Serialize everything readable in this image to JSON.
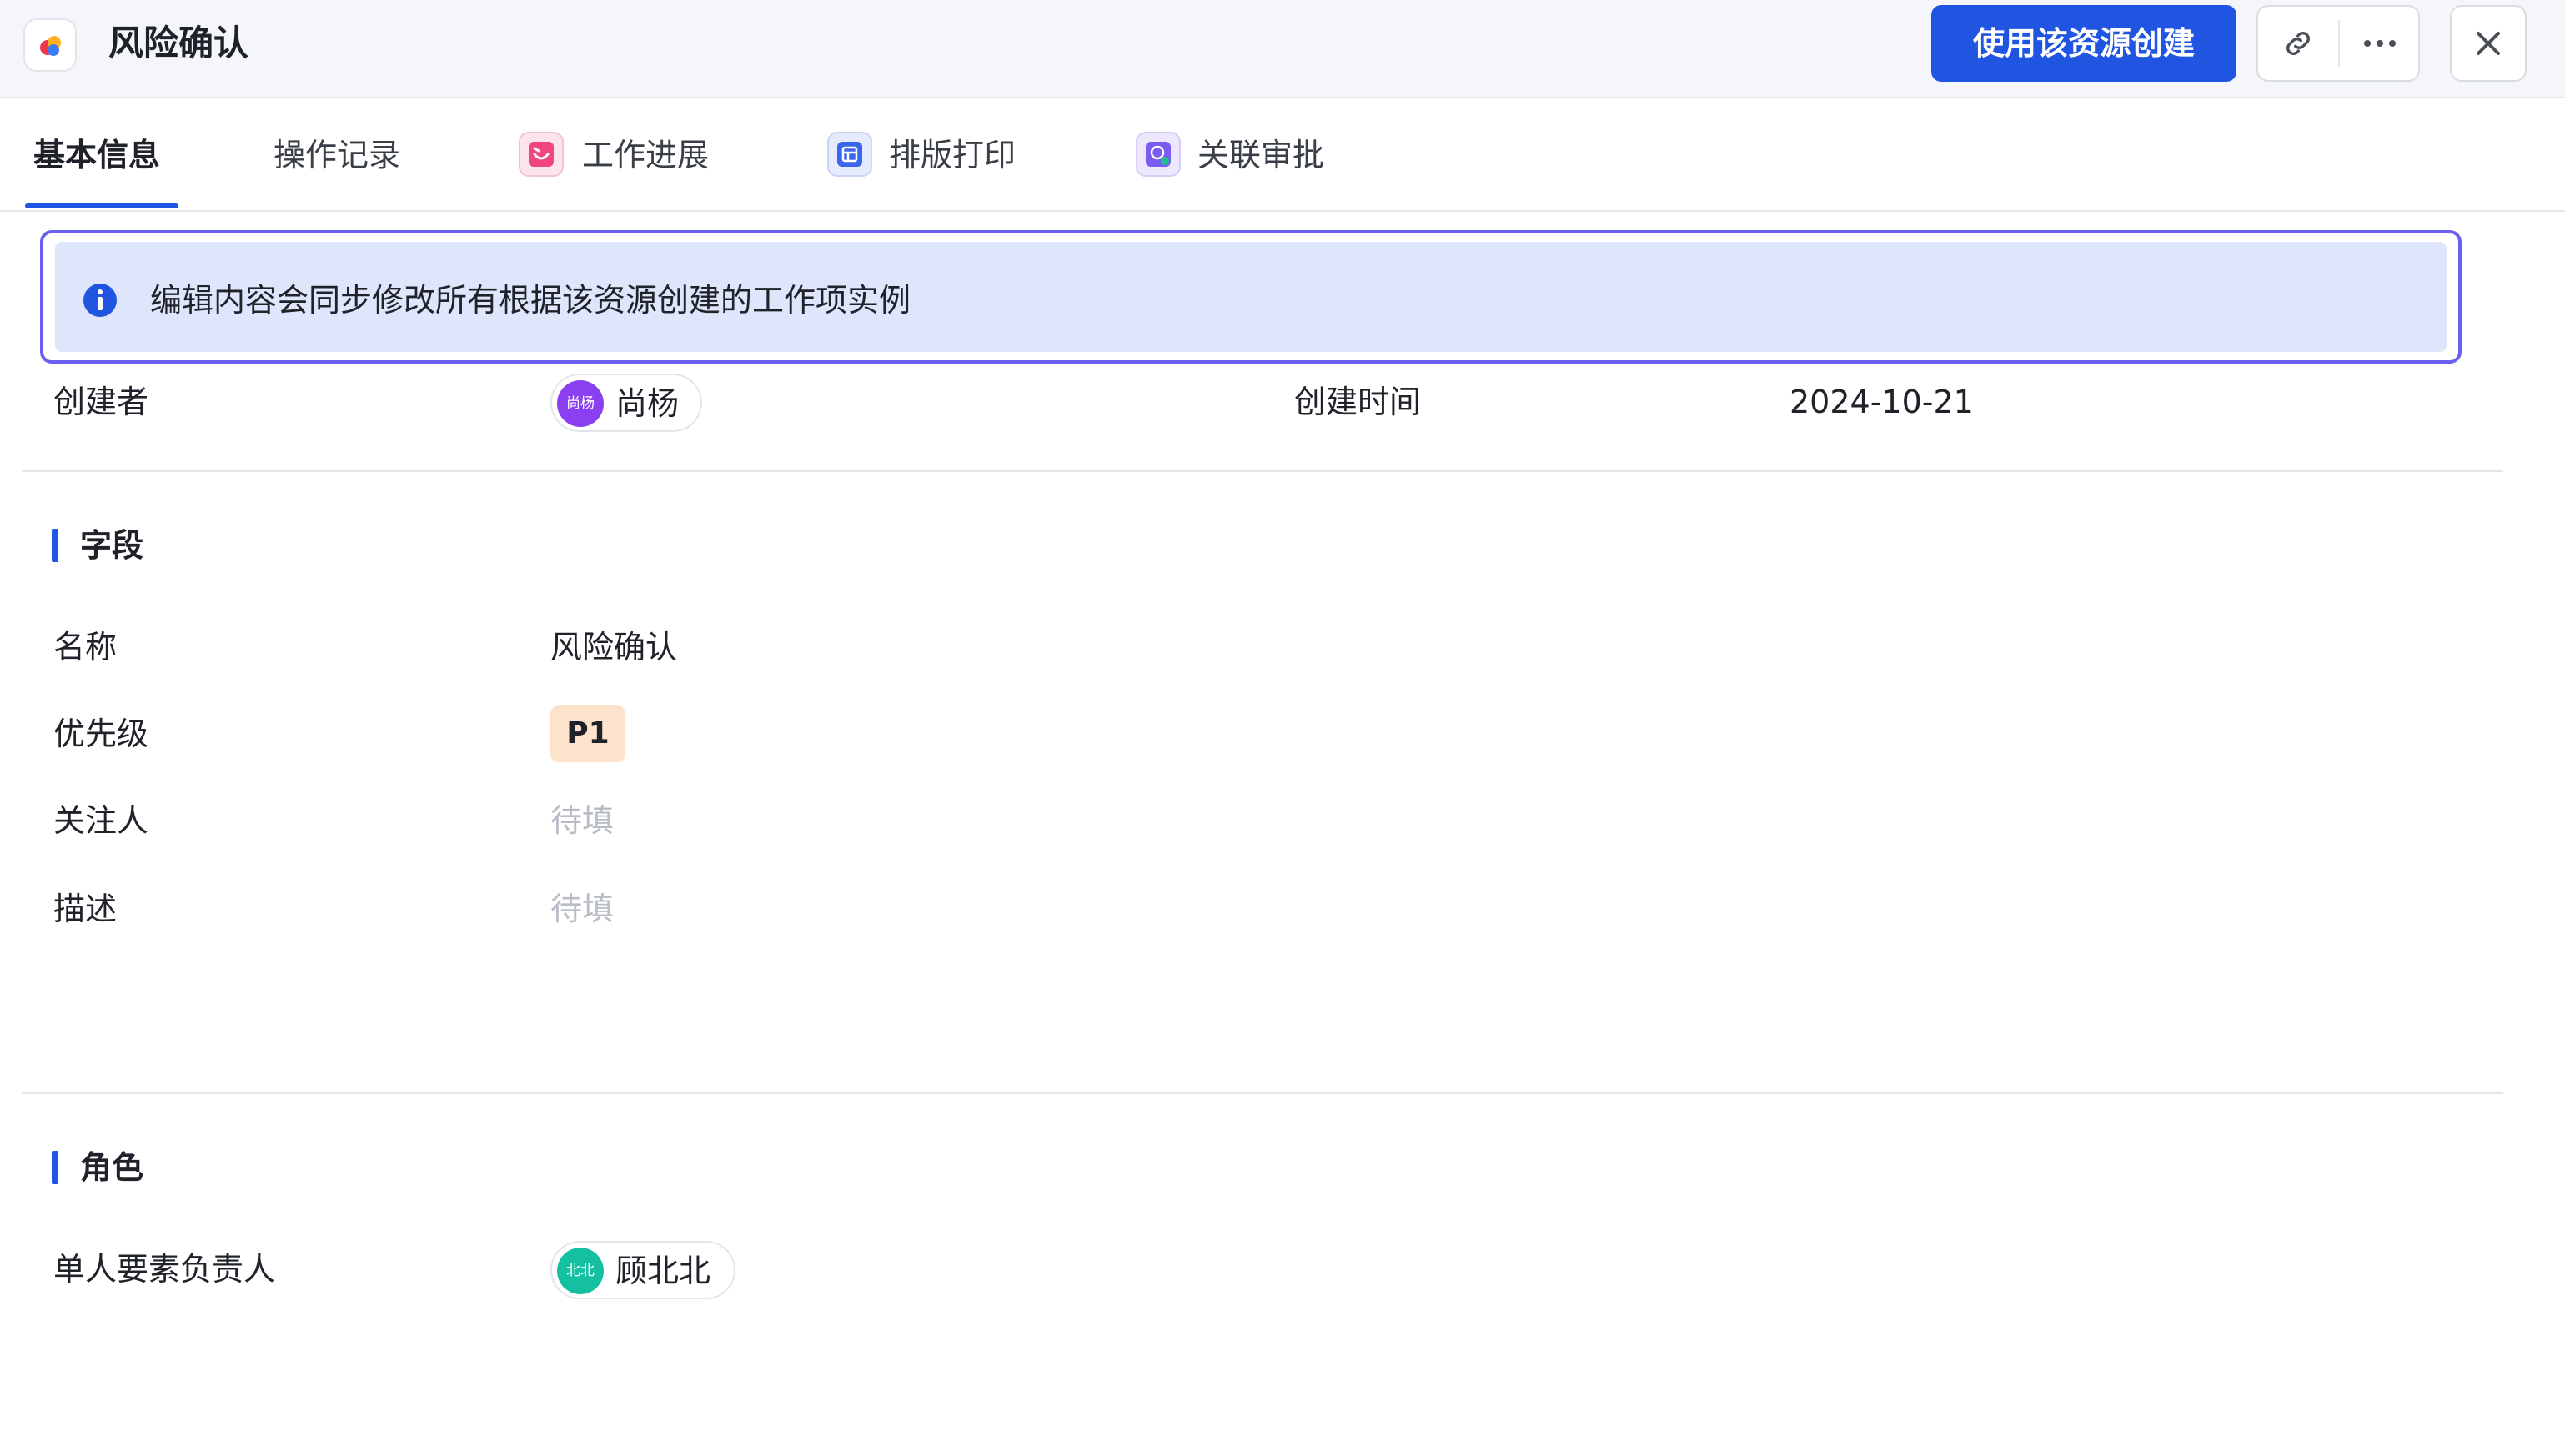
{
  "header": {
    "title": "风险确认",
    "primary_button": "使用该资源创建",
    "icons": [
      "app-logo-icon",
      "link-icon",
      "more-icon",
      "close-icon"
    ]
  },
  "tabs": [
    {
      "label": "基本信息",
      "active": true
    },
    {
      "label": "操作记录"
    },
    {
      "label": "工作进展",
      "icon": "progress-icon"
    },
    {
      "label": "排版打印",
      "icon": "print-layout-icon"
    },
    {
      "label": "关联审批",
      "icon": "approval-icon"
    }
  ],
  "notice": {
    "text": "编辑内容会同步修改所有根据该资源创建的工作项实例",
    "icon": "info-icon"
  },
  "meta": {
    "creator_label": "创建者",
    "creator_avatar": "尚杨",
    "creator_name": "尚杨",
    "created_time_label": "创建时间",
    "created_time": "2024-10-21"
  },
  "fields": {
    "section_title": "字段",
    "name_label": "名称",
    "name_value": "风险确认",
    "priority_label": "优先级",
    "priority_value": "P1",
    "followers_label": "关注人",
    "followers_value": "待填",
    "description_label": "描述",
    "description_value": "待填"
  },
  "roles": {
    "section_title": "角色",
    "owner_label": "单人要素负责人",
    "owner_avatar": "北北",
    "owner_name": "顾北北"
  },
  "colors": {
    "accent": "#1f55e0",
    "notice_bg": "#dfe6fb",
    "notice_border": "#6a5fef",
    "priority_bg": "#fde2cc",
    "creator_avatar_bg": "#8a3ff0",
    "owner_avatar_bg": "#14c0a0"
  }
}
